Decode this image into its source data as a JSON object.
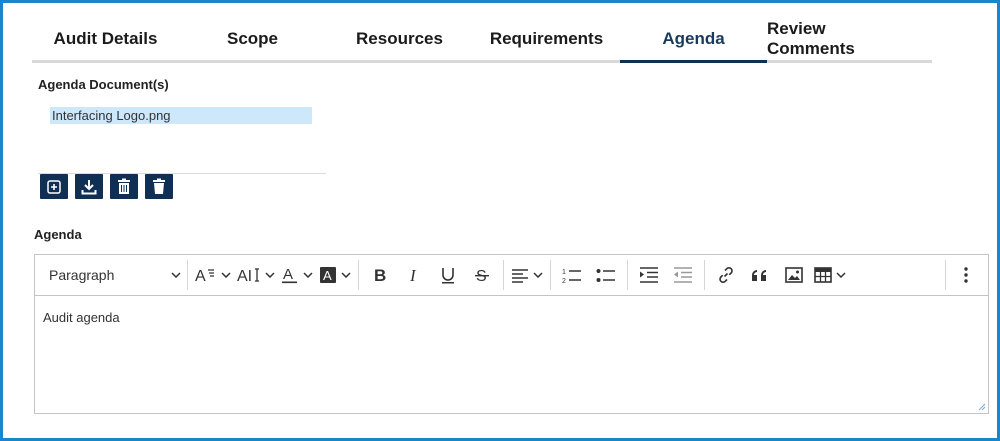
{
  "tabs": [
    {
      "label": "Audit Details",
      "active": false
    },
    {
      "label": "Scope",
      "active": false
    },
    {
      "label": "Resources",
      "active": false
    },
    {
      "label": "Requirements",
      "active": false
    },
    {
      "label": "Agenda",
      "active": true
    },
    {
      "label": "Review Comments",
      "active": false
    }
  ],
  "documents": {
    "label": "Agenda Document(s)",
    "files": [
      "Interfacing Logo.png"
    ],
    "actions": [
      "add-icon",
      "download-icon",
      "delete-all-icon",
      "delete-icon"
    ]
  },
  "agenda": {
    "label": "Agenda",
    "block_format": "Paragraph",
    "toolbar_icons": [
      "font-size-icon",
      "font-family-icon",
      "font-color-icon",
      "background-color-icon",
      "bold-icon",
      "italic-icon",
      "underline-icon",
      "strikethrough-icon",
      "align-icon",
      "numbered-list-icon",
      "bulleted-list-icon",
      "indent-icon",
      "outdent-icon",
      "link-icon",
      "blockquote-icon",
      "image-icon",
      "table-icon",
      "more-icon"
    ],
    "content": "Audit agenda"
  },
  "colors": {
    "frame_border": "#1a86c9",
    "navy": "#0f2f55",
    "active_tab_text": "#1a3a5c",
    "selected_file_bg": "#cde7fb"
  }
}
